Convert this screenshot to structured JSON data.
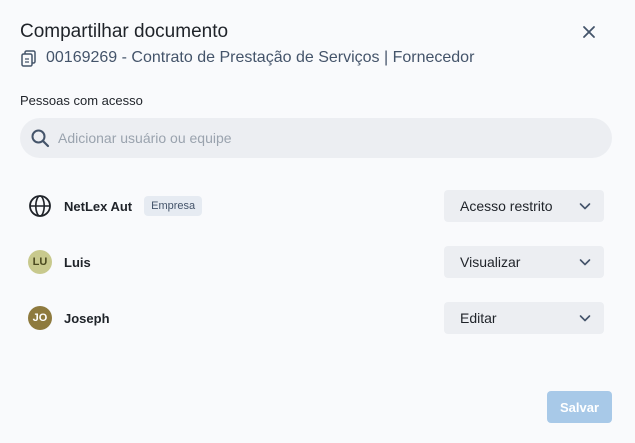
{
  "dialog": {
    "title": "Compartilhar documento",
    "document_name": "00169269 - Contrato de Prestação de Serviços | Fornecedor"
  },
  "access": {
    "section_label": "Pessoas com acesso",
    "search_placeholder": "Adicionar usuário ou equipe",
    "entries": [
      {
        "name": "NetLex Aut",
        "badge": "Empresa",
        "permission": "Acesso restrito",
        "icon": "globe-icon"
      },
      {
        "name": "Luis",
        "initials": "LU",
        "avatar_color": "#c8c98d",
        "permission": "Visualizar"
      },
      {
        "name": "Joseph",
        "initials": "JO",
        "avatar_color": "#8e7a3e",
        "permission": "Editar"
      }
    ]
  },
  "footer": {
    "save_label": "Salvar"
  },
  "colors": {
    "background": "#f9fafc",
    "save_button": "#a8c9e8",
    "field_background": "#eceef2"
  }
}
